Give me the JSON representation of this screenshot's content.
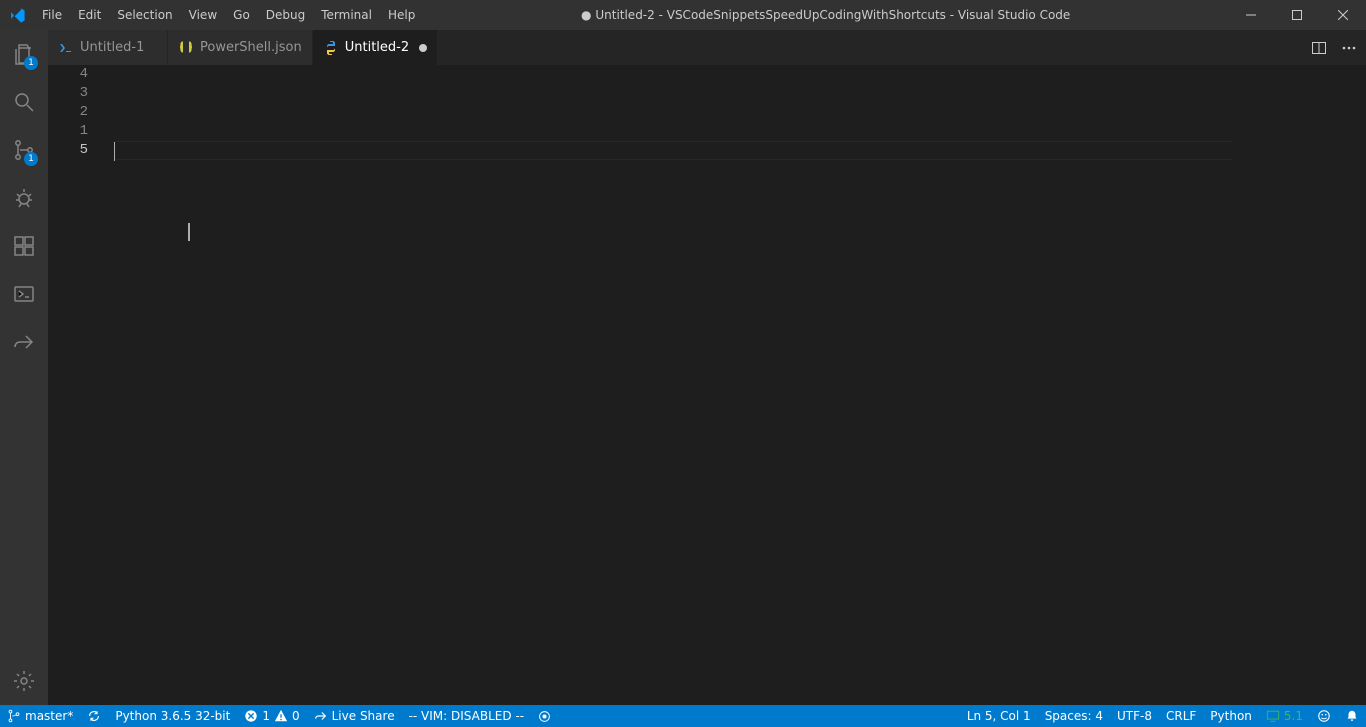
{
  "title": {
    "dirty_dot": "●",
    "text": "Untitled-2 - VSCodeSnippetsSpeedUpCodingWithShortcuts - Visual Studio Code"
  },
  "menu": [
    "File",
    "Edit",
    "Selection",
    "View",
    "Go",
    "Debug",
    "Terminal",
    "Help"
  ],
  "activity": {
    "explorer_badge": "1",
    "scm_badge": "1"
  },
  "tabs": [
    {
      "label": "Untitled-1",
      "icon": "powershell",
      "active": false
    },
    {
      "label": "PowerShell.json",
      "icon": "json",
      "active": false
    },
    {
      "label": "Untitled-2",
      "icon": "python",
      "active": true,
      "dirty": true
    }
  ],
  "editor": {
    "gutter_lines": [
      "4",
      "3",
      "2",
      "1",
      "5"
    ],
    "current_index": 4
  },
  "status": {
    "branch": "master*",
    "python": "Python 3.6.5 32-bit",
    "errors": "1",
    "warnings": "0",
    "live_share": "Live Share",
    "vim": "-- VIM: DISABLED --",
    "cursor": "Ln 5, Col 1",
    "spaces": "Spaces: 4",
    "encoding": "UTF-8",
    "eol": "CRLF",
    "lang": "Python",
    "feedback_ver": "5.1"
  }
}
